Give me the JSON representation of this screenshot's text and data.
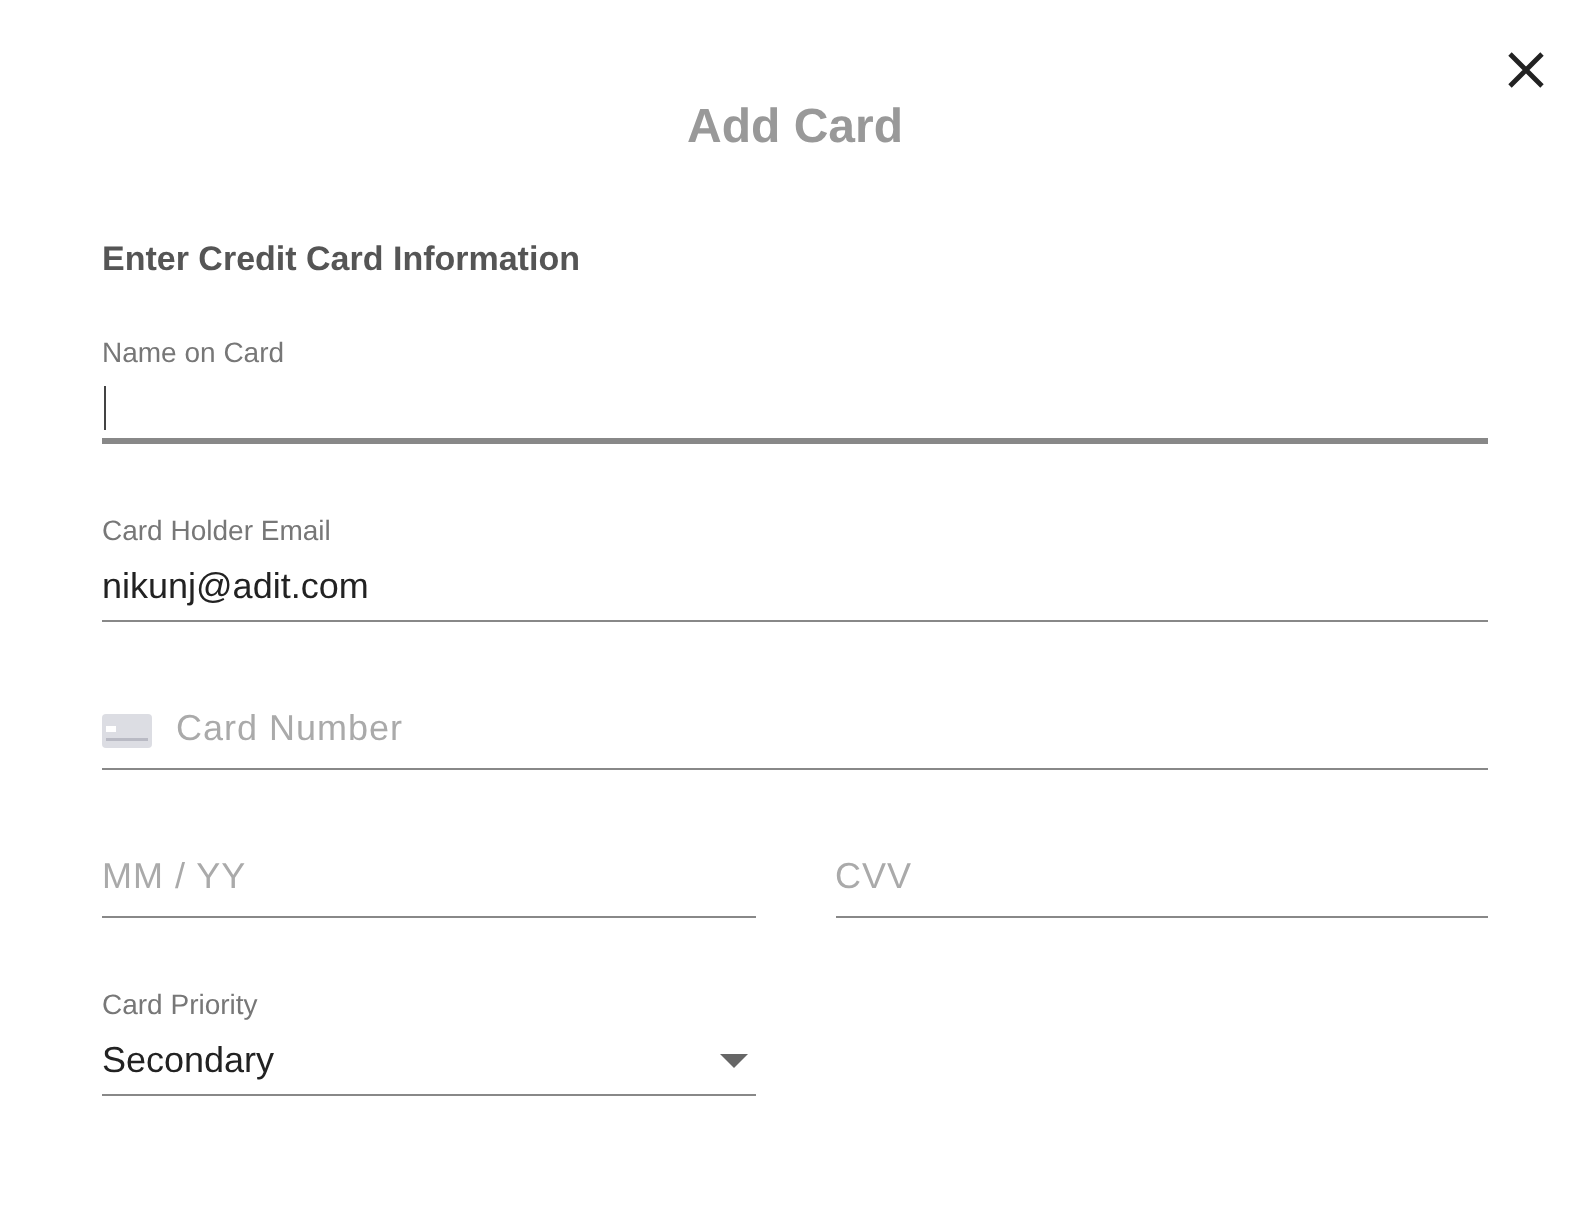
{
  "dialog": {
    "title": "Add Card",
    "section_title": "Enter Credit Card Information",
    "fields": [
      {
        "kind": "text",
        "label": "Name on Card",
        "focused": true
      },
      {
        "kind": "text",
        "label": "Card Holder Email",
        "value": "nikunj@adit.com",
        "focused": false
      },
      {
        "kind": "card",
        "placeholder": "Card Number",
        "focused": false
      },
      {
        "kind": "pair",
        "items": [
          {
            "placeholder": "MM / YY",
            "focused": false
          },
          {
            "placeholder": "CVV",
            "focused": false
          }
        ]
      },
      {
        "kind": "select",
        "label": "Card Priority",
        "value": "Secondary"
      }
    ]
  }
}
